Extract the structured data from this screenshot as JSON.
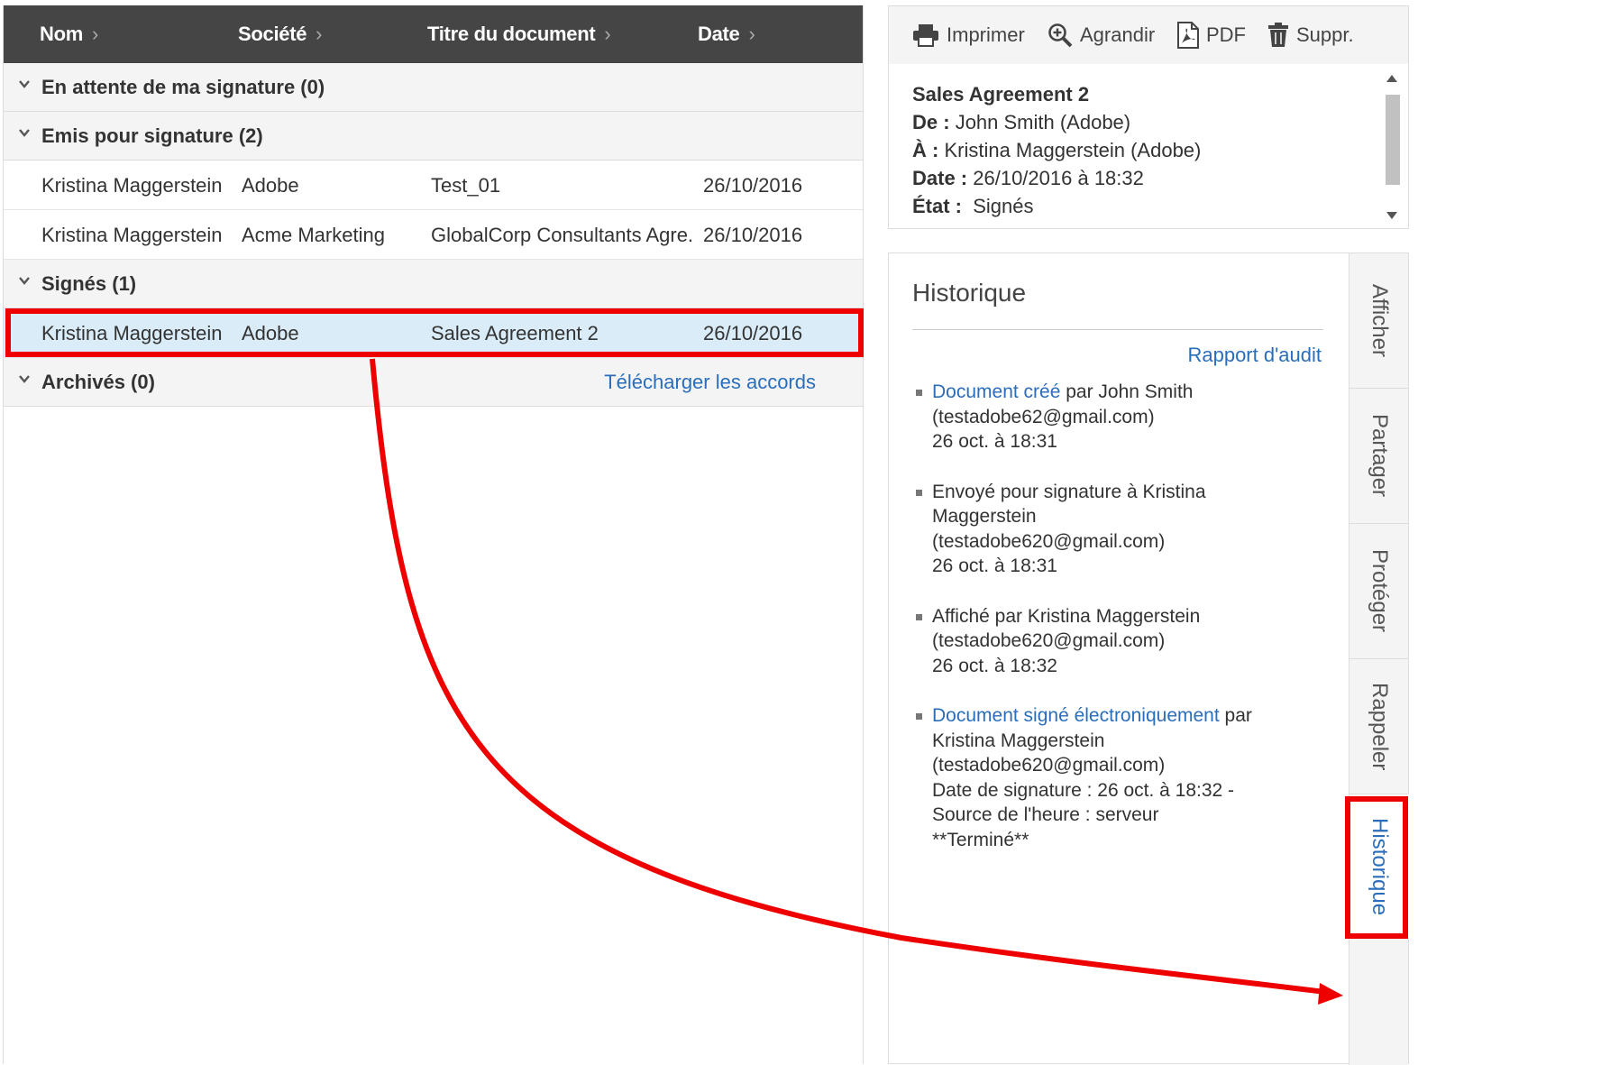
{
  "columns": [
    {
      "label": "Nom"
    },
    {
      "label": "Société"
    },
    {
      "label": "Titre du document"
    },
    {
      "label": "Date"
    }
  ],
  "groups": {
    "pending": {
      "label": "En attente de ma signature (0)"
    },
    "sent": {
      "label": "Emis pour signature (2)"
    },
    "signed": {
      "label": "Signés (1)"
    },
    "archived": {
      "label": "Archivés (0)",
      "download_link": "Télécharger les accords"
    }
  },
  "rows": [
    {
      "name": "Kristina Maggerstein",
      "company": "Adobe",
      "title": "Test_01",
      "date": "26/10/2016"
    },
    {
      "name": "Kristina Maggerstein",
      "company": "Acme Marketing",
      "title": "GlobalCorp Consultants Agre...",
      "date": "26/10/2016"
    },
    {
      "name": "Kristina Maggerstein",
      "company": "Adobe",
      "title": "Sales Agreement 2",
      "date": "26/10/2016"
    }
  ],
  "toolbar": {
    "print": "Imprimer",
    "zoom": "Agrandir",
    "pdf": "PDF",
    "delete": "Suppr."
  },
  "details": {
    "title": "Sales Agreement 2",
    "from_label": "De :",
    "from_value": "John Smith (Adobe)",
    "to_label": "À :",
    "to_value": "Kristina Maggerstein (Adobe)",
    "date_label": "Date :",
    "date_value": "26/10/2016 à 18:32",
    "state_label": "État :",
    "state_value": "Signés"
  },
  "history": {
    "title": "Historique",
    "audit_link": "Rapport d'audit",
    "events": [
      {
        "link": "Document créé",
        "line1": " par John Smith",
        "line2": "(testadobe62@gmail.com)",
        "line3": "26 oct. à 18:31"
      },
      {
        "line1": "Envoyé pour signature à Kristina",
        "line2": "Maggerstein",
        "line3": "(testadobe620@gmail.com)",
        "line4": "26 oct. à 18:31"
      },
      {
        "line1": "Affiché par Kristina Maggerstein",
        "line2": "(testadobe620@gmail.com)",
        "line3": "26 oct. à 18:32"
      },
      {
        "link": "Document signé électroniquement",
        "line1": " par",
        "line2": "Kristina Maggerstein",
        "line3": "(testadobe620@gmail.com)",
        "line4": "Date de signature : 26 oct. à 18:32 -",
        "line5": "Source de l'heure : serveur",
        "line6": "**Terminé**"
      }
    ]
  },
  "side_tabs": [
    "Afficher",
    "Partager",
    "Protéger",
    "Rappeler",
    "Historique"
  ],
  "colors": {
    "accent": "#2a6ebb",
    "header_bg": "#454545",
    "selected_row": "#d9ecf8",
    "annotation": "#e00000"
  }
}
